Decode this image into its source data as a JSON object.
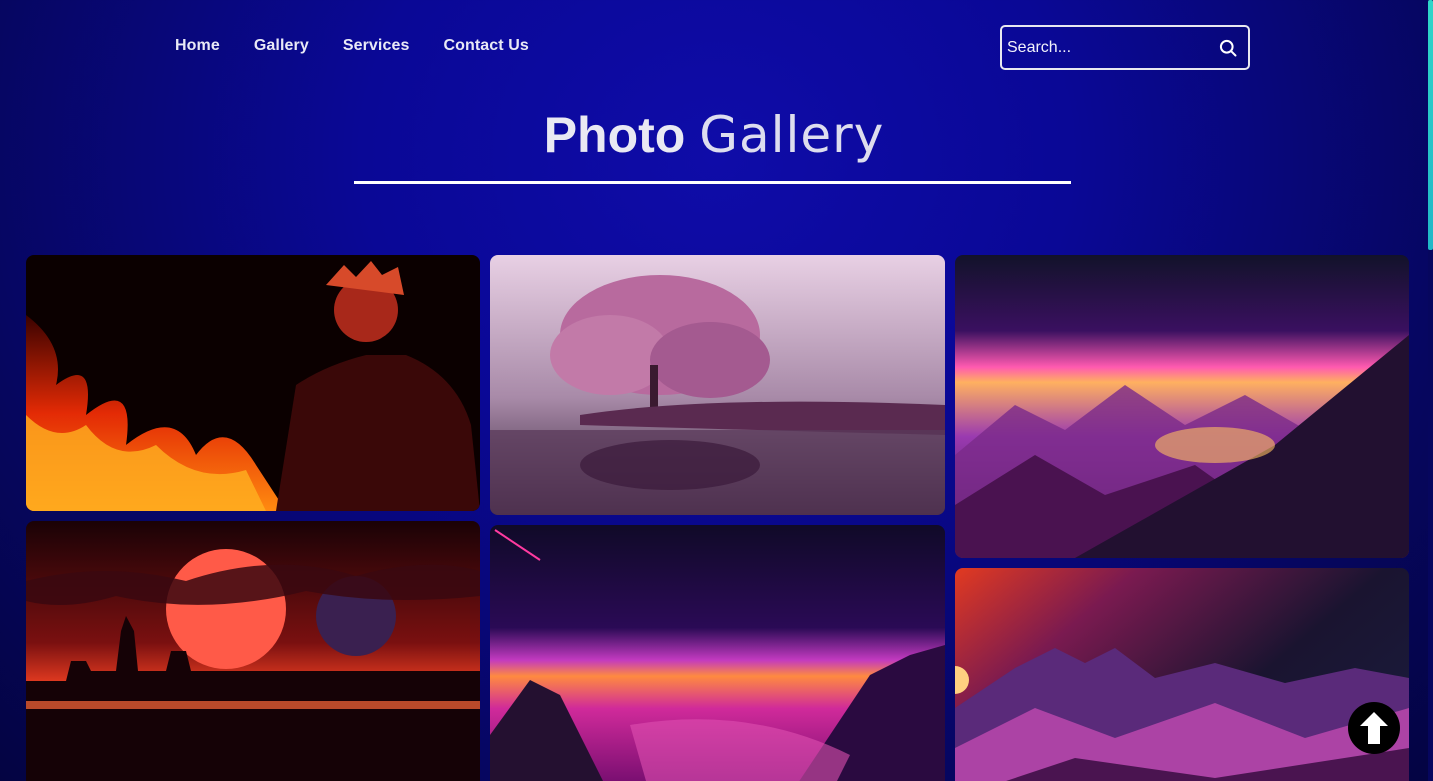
{
  "nav": {
    "links": [
      {
        "label": "Home"
      },
      {
        "label": "Gallery"
      },
      {
        "label": "Services"
      },
      {
        "label": "Contact Us"
      }
    ]
  },
  "search": {
    "placeholder": "Search...",
    "value": "",
    "icon": "search-icon"
  },
  "header": {
    "title_bold": "Photo",
    "title_light": "Gallery"
  },
  "gallery": {
    "photos": [
      {
        "subject": "anime character with fire"
      },
      {
        "subject": "pink tree on misty lake"
      },
      {
        "subject": "purple mountain sunset"
      },
      {
        "subject": "red moon city skyline"
      },
      {
        "subject": "pink mountain horizon"
      },
      {
        "subject": "orange purple mountains"
      }
    ]
  },
  "scroll_top": {
    "icon": "arrow-up-icon"
  },
  "colors": {
    "background": "#0a0896",
    "accent": "#ffffff",
    "scrollbar": "#2fd6c8"
  }
}
